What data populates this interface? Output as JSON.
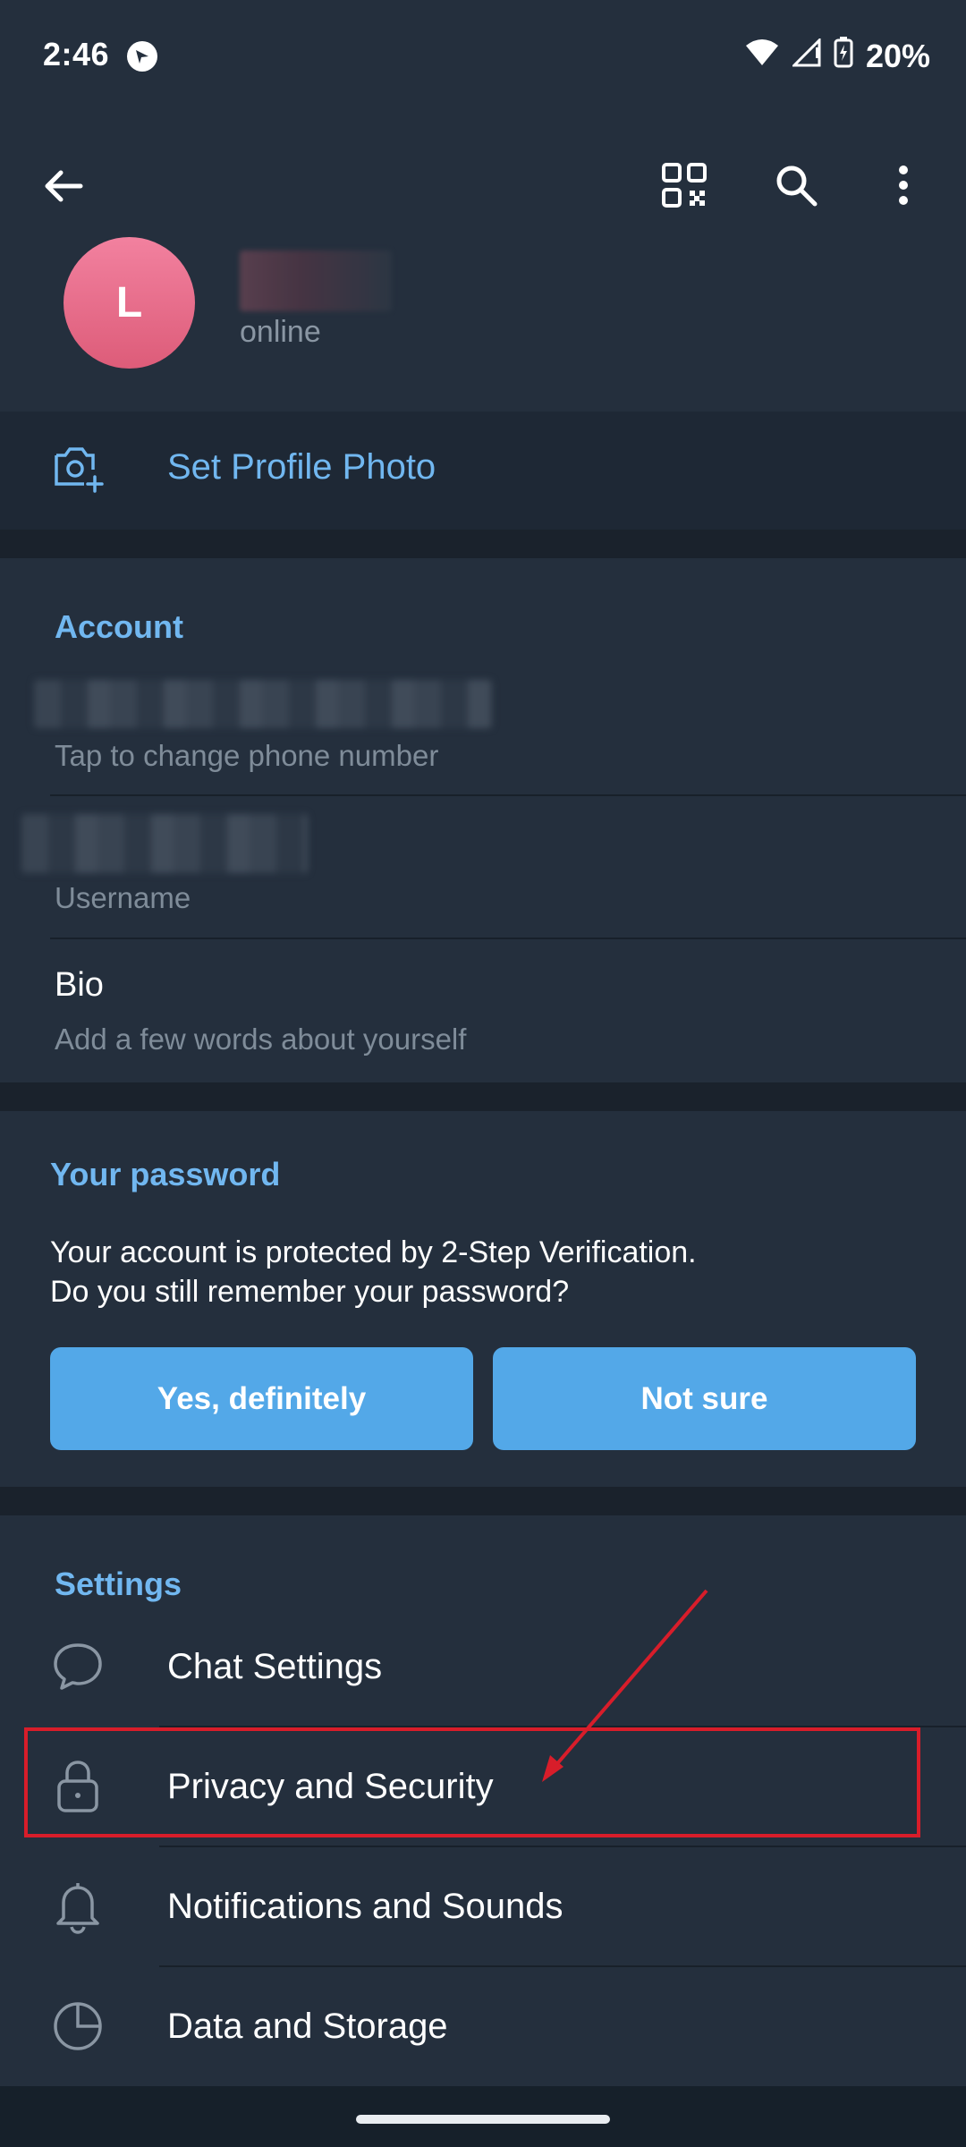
{
  "status_bar": {
    "time": "2:46",
    "battery": "20%"
  },
  "profile": {
    "avatar_initial": "L",
    "status": "online"
  },
  "actions": {
    "set_photo": "Set Profile Photo"
  },
  "account": {
    "title": "Account",
    "phone_hint": "Tap to change phone number",
    "username_hint": "Username",
    "bio_label": "Bio",
    "bio_hint": "Add a few words about yourself"
  },
  "password": {
    "title": "Your password",
    "text_line1": "Your account is protected by 2-Step Verification.",
    "text_line2": "Do you still remember your password?",
    "yes_button": "Yes, definitely",
    "not_sure_button": "Not sure"
  },
  "settings": {
    "title": "Settings",
    "items": [
      {
        "label": "Chat Settings",
        "icon": "chat-bubble-icon"
      },
      {
        "label": "Privacy and Security",
        "icon": "lock-icon"
      },
      {
        "label": "Notifications and Sounds",
        "icon": "bell-icon"
      },
      {
        "label": "Data and Storage",
        "icon": "pie-chart-icon"
      }
    ]
  },
  "colors": {
    "accent": "#71b7f0",
    "button": "#53a8e8",
    "highlight": "#d81d2a"
  }
}
